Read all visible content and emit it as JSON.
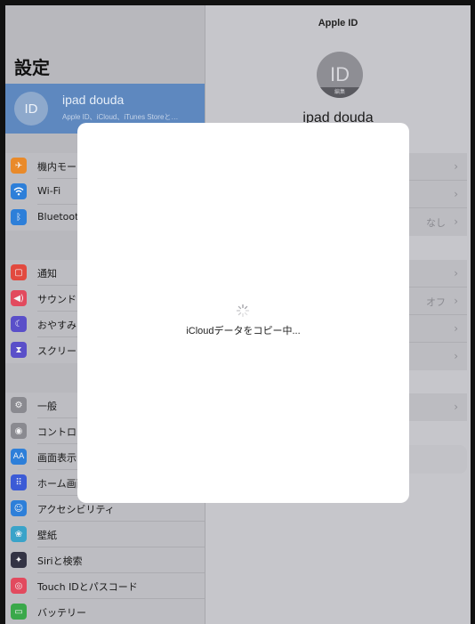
{
  "sidebar": {
    "title": "設定",
    "profile": {
      "avatar_initials": "ID",
      "name": "ipad douda",
      "subtitle": "Apple ID、iCloud、iTunes Storeと…"
    },
    "items": [
      {
        "label": "機内モード",
        "icon": "airplane-icon",
        "color": "#e98a2a"
      },
      {
        "label": "Wi-Fi",
        "icon": "wifi-icon",
        "color": "#2d7fd9"
      },
      {
        "label": "Bluetooth",
        "icon": "bluetooth-icon",
        "color": "#2d7fd9"
      },
      {
        "label": "通知",
        "icon": "notification-icon",
        "color": "#e24a3f"
      },
      {
        "label": "サウンド",
        "icon": "sound-icon",
        "color": "#e24a5e"
      },
      {
        "label": "おやすみモード",
        "icon": "moon-icon",
        "color": "#5a4fc9"
      },
      {
        "label": "スクリーンタイム",
        "icon": "hourglass-icon",
        "color": "#5a4fc9"
      },
      {
        "label": "一般",
        "icon": "gear-icon",
        "color": "#8a8a90"
      },
      {
        "label": "コントロールセンター",
        "icon": "toggle-icon",
        "color": "#8a8a90"
      },
      {
        "label": "画面表示と明るさ",
        "icon": "display-icon",
        "color": "#2d7fd9"
      },
      {
        "label": "ホーム画面とDock",
        "icon": "home-grid-icon",
        "color": "#3b5bd6"
      },
      {
        "label": "アクセシビリティ",
        "icon": "accessibility-icon",
        "color": "#2d7fd9"
      },
      {
        "label": "壁紙",
        "icon": "wallpaper-icon",
        "color": "#3aa3c9"
      },
      {
        "label": "Siriと検索",
        "icon": "siri-icon",
        "color": "#333344"
      },
      {
        "label": "Touch IDとパスコード",
        "icon": "fingerprint-icon",
        "color": "#e24a5e"
      },
      {
        "label": "バッテリー",
        "icon": "battery-icon",
        "color": "#3aa84a"
      }
    ]
  },
  "detail": {
    "header": "Apple ID",
    "avatar_initials": "ID",
    "avatar_edit": "編集",
    "name": "ipad douda",
    "values": {
      "bluetooth": "なし",
      "sound": "オフ"
    }
  },
  "modal": {
    "message": "iCloudデータをコピー中..."
  }
}
